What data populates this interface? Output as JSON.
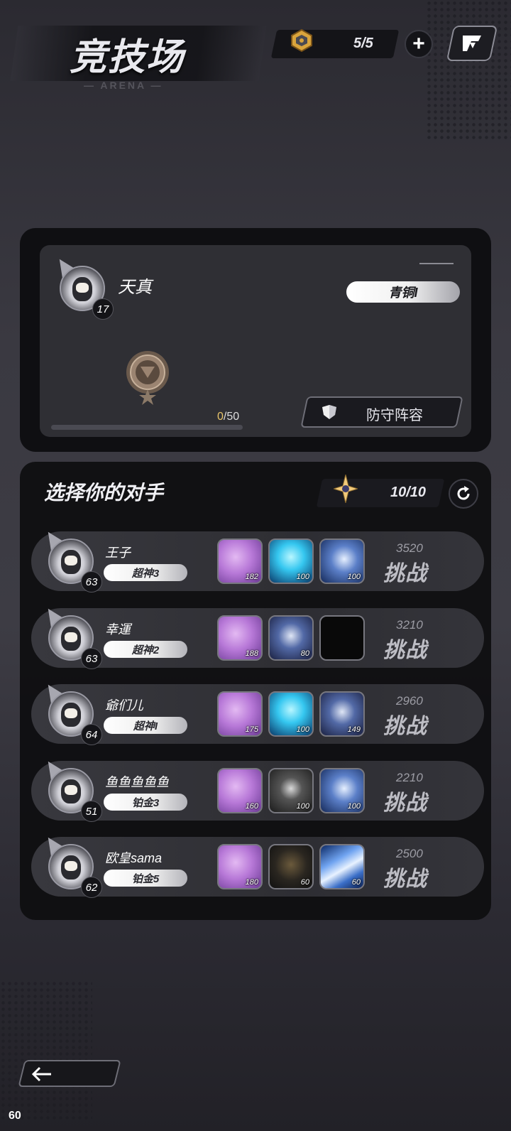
{
  "header": {
    "title": "竞技场",
    "subtitle": "— ARENA —",
    "ticket_count": "5/5",
    "plus_label": "+"
  },
  "player": {
    "name": "天真",
    "level": "17",
    "rank": "青铜I",
    "progress_current": "0",
    "progress_max": "/50",
    "progress_fraction": 0,
    "defense_label": "防守阵容"
  },
  "opponents_panel": {
    "title": "选择你的对手",
    "challenge_count": "10/10",
    "challenge_label": "挑战",
    "rows": [
      {
        "name": "王子",
        "level": "63",
        "rank": "超神3",
        "score": "3520",
        "monsters": [
          {
            "type": "purple",
            "power": "182"
          },
          {
            "type": "cyan",
            "power": "100"
          },
          {
            "type": "blue",
            "power": "100"
          }
        ]
      },
      {
        "name": "幸運",
        "level": "63",
        "rank": "超神2",
        "score": "3210",
        "monsters": [
          {
            "type": "purple",
            "power": "188"
          },
          {
            "type": "navy",
            "power": "80"
          },
          {
            "type": "black",
            "power": ""
          }
        ]
      },
      {
        "name": "爺们儿",
        "level": "64",
        "rank": "超神I",
        "score": "2960",
        "monsters": [
          {
            "type": "purple",
            "power": "175"
          },
          {
            "type": "cyan",
            "power": "100"
          },
          {
            "type": "navy",
            "power": "149"
          }
        ]
      },
      {
        "name": "鱼鱼鱼鱼鱼",
        "level": "51",
        "rank": "铂金3",
        "score": "2210",
        "monsters": [
          {
            "type": "purple",
            "power": "160"
          },
          {
            "type": "dark",
            "power": "100"
          },
          {
            "type": "blue",
            "power": "100"
          }
        ]
      },
      {
        "name": "欧皇sama",
        "level": "62",
        "rank": "铂金5",
        "score": "2500",
        "monsters": [
          {
            "type": "purple",
            "power": "180"
          },
          {
            "type": "gold",
            "power": "60"
          },
          {
            "type": "ice",
            "power": "60"
          }
        ]
      }
    ]
  },
  "footer": {
    "back_icon": "back-arrow-icon",
    "fps": "60"
  },
  "colors": {
    "accent_gold": "#e9c56a",
    "panel_bg": "#0f0f12",
    "card_bg": "#2f2f34"
  }
}
